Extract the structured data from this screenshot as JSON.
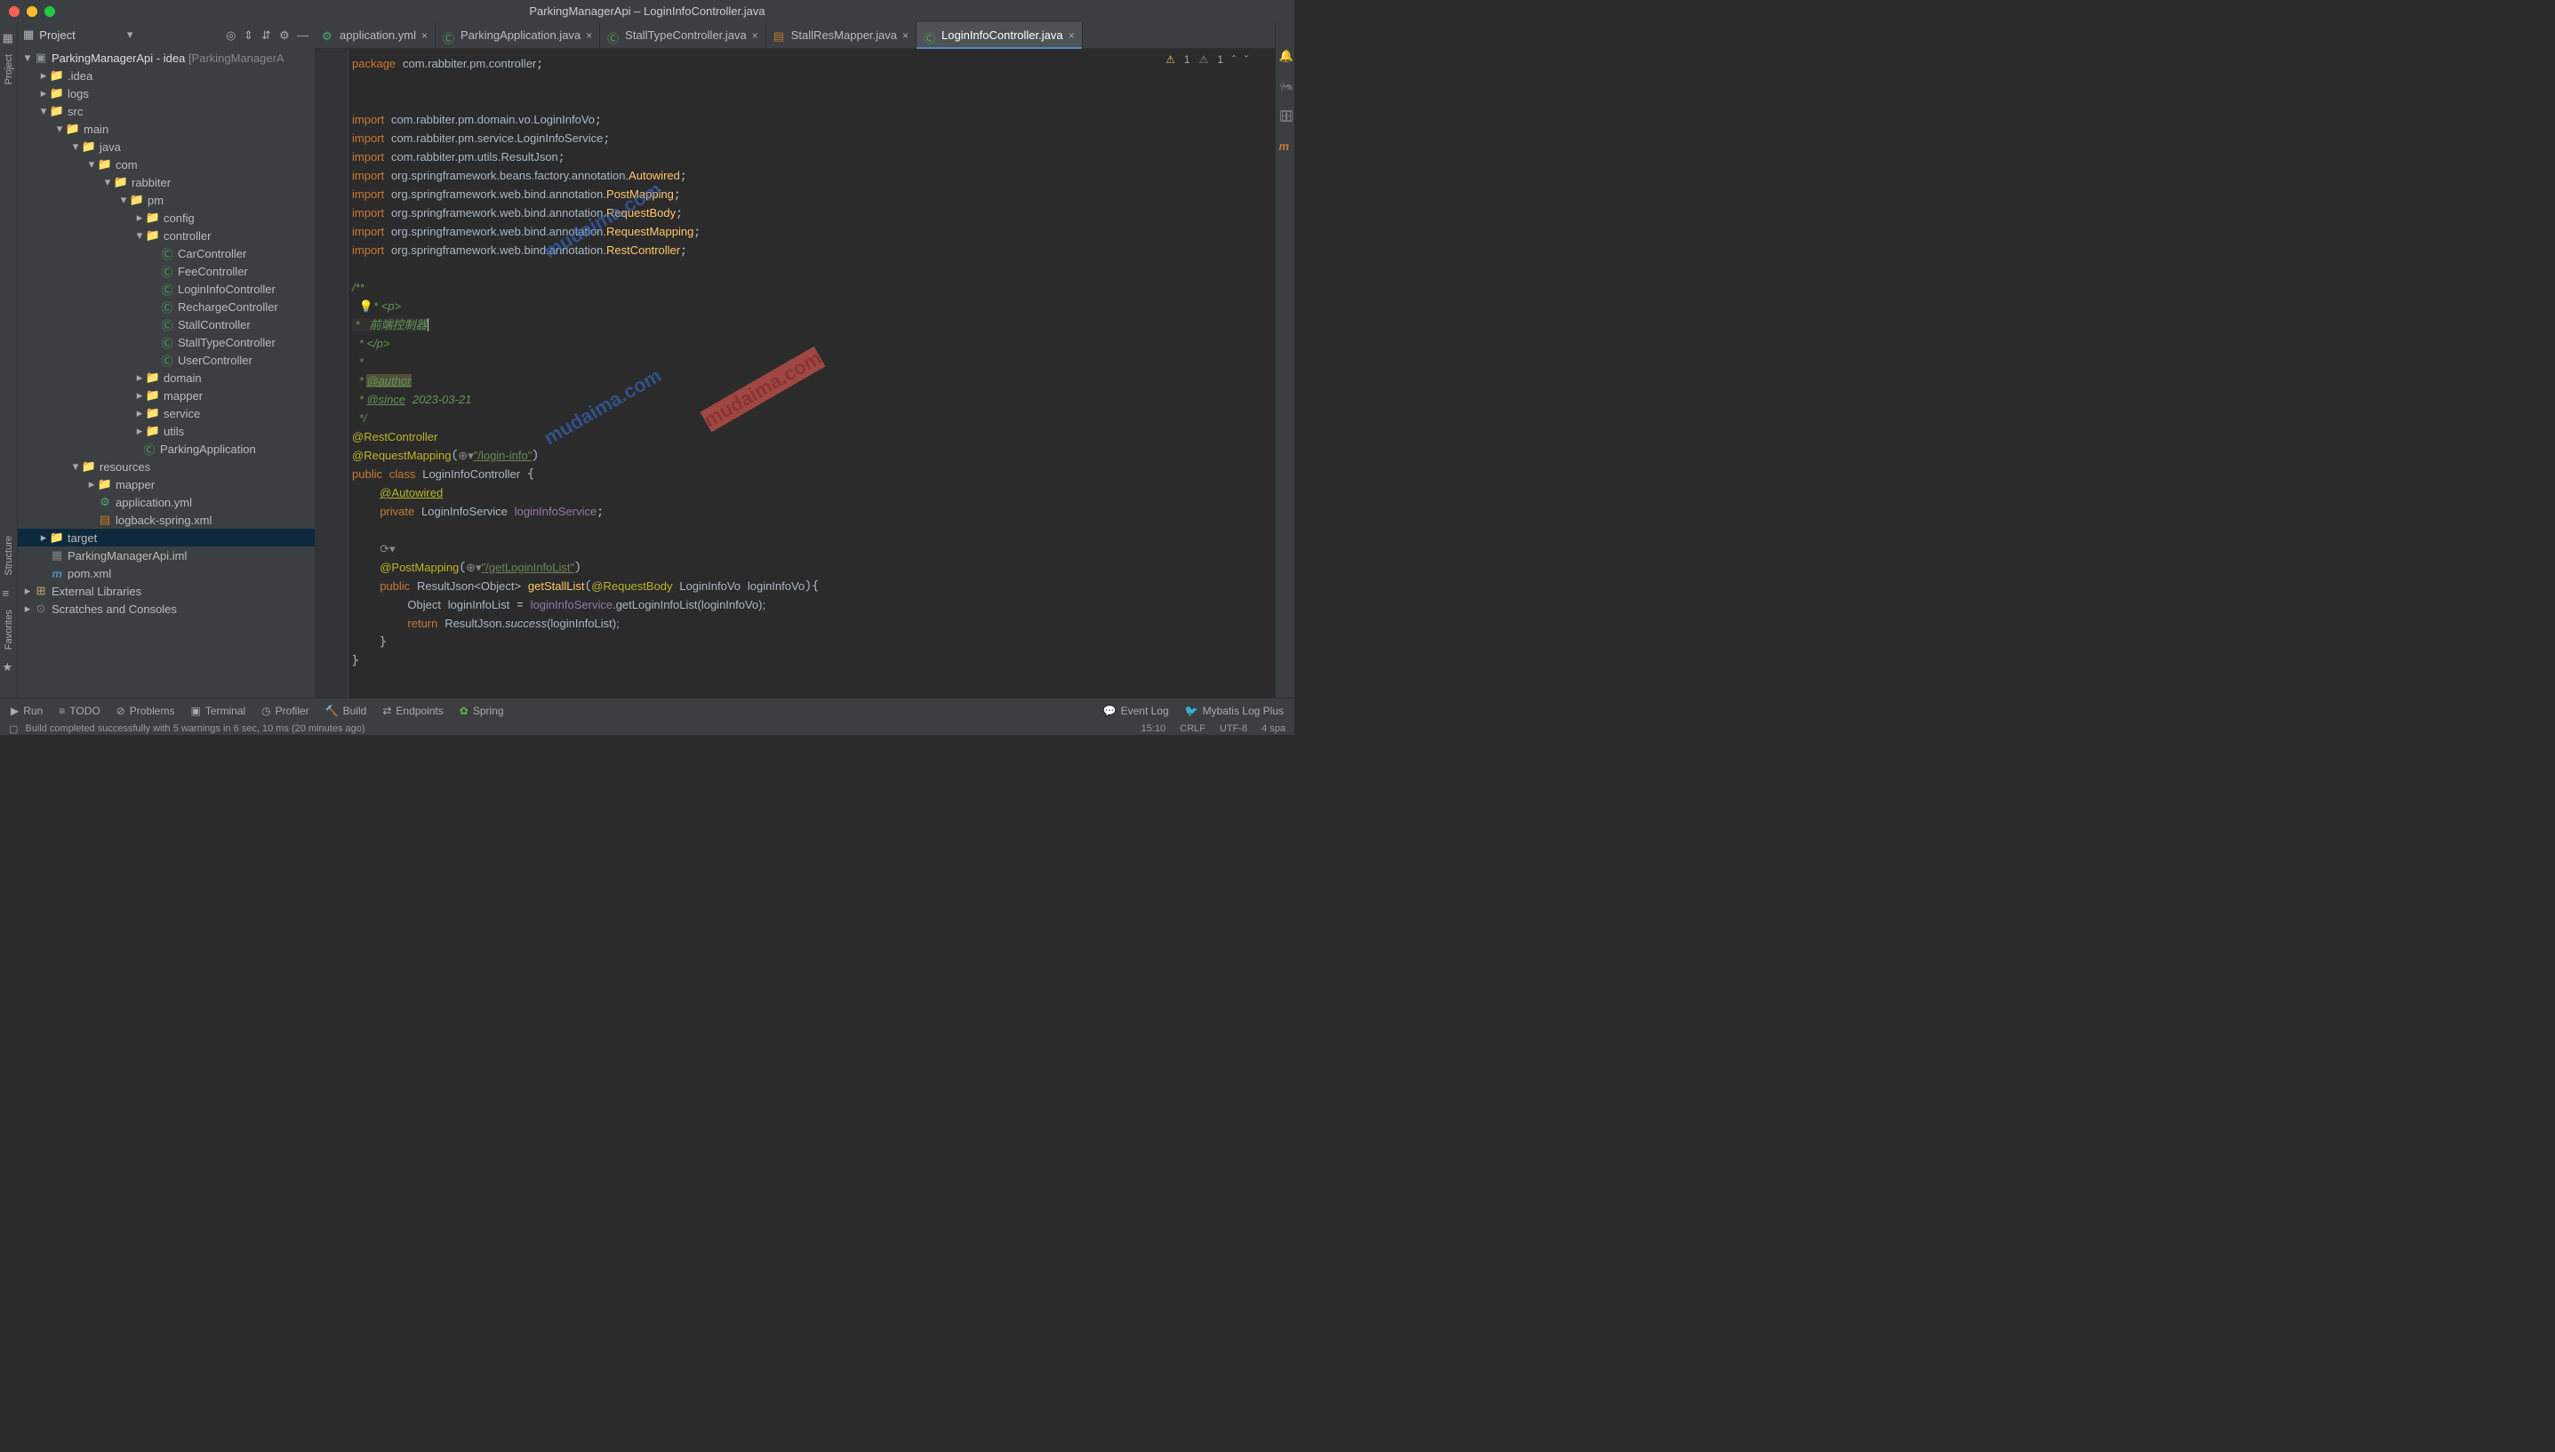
{
  "window": {
    "title": "ParkingManagerApi – LoginInfoController.java"
  },
  "panel": {
    "title": "Project"
  },
  "tree": {
    "root": "ParkingManagerApi - idea",
    "root_suffix": "[ParkingManagerA",
    "idea": ".idea",
    "logs": "logs",
    "src": "src",
    "main": "main",
    "java": "java",
    "com": "com",
    "rabbiter": "rabbiter",
    "pm": "pm",
    "config": "config",
    "controller": "controller",
    "c1": "CarController",
    "c2": "FeeController",
    "c3": "LoginInfoController",
    "c4": "RechargeController",
    "c5": "StallController",
    "c6": "StallTypeController",
    "c7": "UserController",
    "domain": "domain",
    "mapper": "mapper",
    "service": "service",
    "utils": "utils",
    "parkingapp": "ParkingApplication",
    "resources": "resources",
    "mapper2": "mapper",
    "appyml": "application.yml",
    "logback": "logback-spring.xml",
    "target": "target",
    "iml": "ParkingManagerApi.iml",
    "pom": "pom.xml",
    "extlib": "External Libraries",
    "scratch": "Scratches and Consoles"
  },
  "tabs": {
    "t1": "application.yml",
    "t2": "ParkingApplication.java",
    "t3": "StallTypeController.java",
    "t4": "StallResMapper.java",
    "t5": "LoginInfoController.java"
  },
  "code": {
    "pkg_kw": "package",
    "pkg_val": "com.rabbiter.pm.controller",
    "imp": "import",
    "i1": "com.rabbiter.pm.domain.vo.LoginInfoVo",
    "i2": "com.rabbiter.pm.service.LoginInfoService",
    "i3": "com.rabbiter.pm.utils.ResultJson",
    "i4a": "org.springframework.beans.factory.annotation.",
    "i4b": "Autowired",
    "i5a": "org.springframework.web.bind.annotation.",
    "i5b": "PostMapping",
    "i6b": "RequestBody",
    "i7b": "RequestMapping",
    "i8b": "RestController",
    "docstart": "/**",
    "docp": "* <p>",
    "doccn": "*   前端控制器",
    "docpend": "* </p>",
    "docstar": "*",
    "author": "@author",
    "since": "@since",
    "since_date": "2023-03-21",
    "docend": "*/",
    "arest": "@RestController",
    "areqmap": "@RequestMapping",
    "reqmap_str": "\"/login-info\"",
    "public": "public",
    "class": "class",
    "classname": "LoginInfoController",
    "aautowired": "@Autowired",
    "private": "private",
    "svc_type": "LoginInfoService",
    "svc_name": "loginInfoService",
    "apostmap": "@PostMapping",
    "postmap_str": "\"/getLoginInfoList\"",
    "ret_type": "ResultJson<Object>",
    "method": "getStallList",
    "areqbody": "@RequestBody",
    "param_type": "LoginInfoVo",
    "param_name": "loginInfoVo",
    "obj": "Object",
    "var": "loginInfoList",
    "call": ".getLoginInfoList(loginInfoVo);",
    "return": "return",
    "rj": "ResultJson.",
    "success": "success",
    "tail": "(loginInfoList);"
  },
  "warnings": {
    "w1": "1",
    "w2": "1"
  },
  "bottom": {
    "run": "Run",
    "todo": "TODO",
    "problems": "Problems",
    "terminal": "Terminal",
    "profiler": "Profiler",
    "build": "Build",
    "endpoints": "Endpoints",
    "spring": "Spring",
    "eventlog": "Event Log",
    "mybatis": "Mybatis Log Plus"
  },
  "status": {
    "msg": "Build completed successfully with 5 warnings in 6 sec, 10 ms (20 minutes ago)",
    "pos": "15:10",
    "crlf": "CRLF",
    "enc": "UTF-8",
    "spaces": "4 spa"
  },
  "watermark": "mudaima.com",
  "rail": {
    "proj": "Project",
    "struct": "Structure",
    "fav": "Favorites"
  }
}
